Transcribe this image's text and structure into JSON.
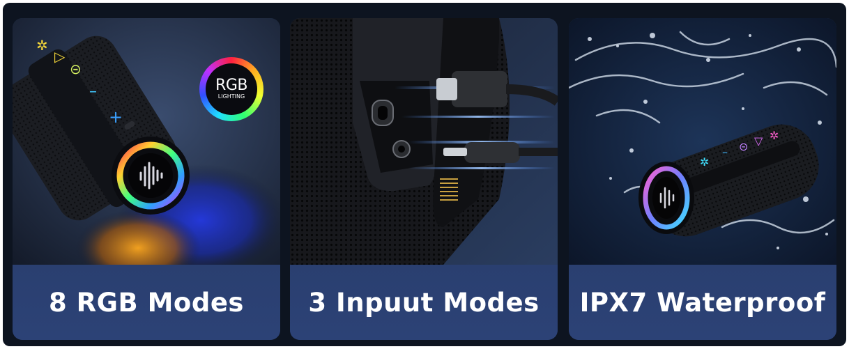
{
  "cards": [
    {
      "caption": "8 RGB Modes",
      "badge_line1": "RGB",
      "badge_line2": "LIGHTING"
    },
    {
      "caption": "3 Inpuut Modes"
    },
    {
      "caption": "IPX7 Waterproof"
    }
  ],
  "colors": {
    "card_top": "#1a2a4a",
    "card_bottom": "#2c4276",
    "frame": "#0d1420"
  }
}
